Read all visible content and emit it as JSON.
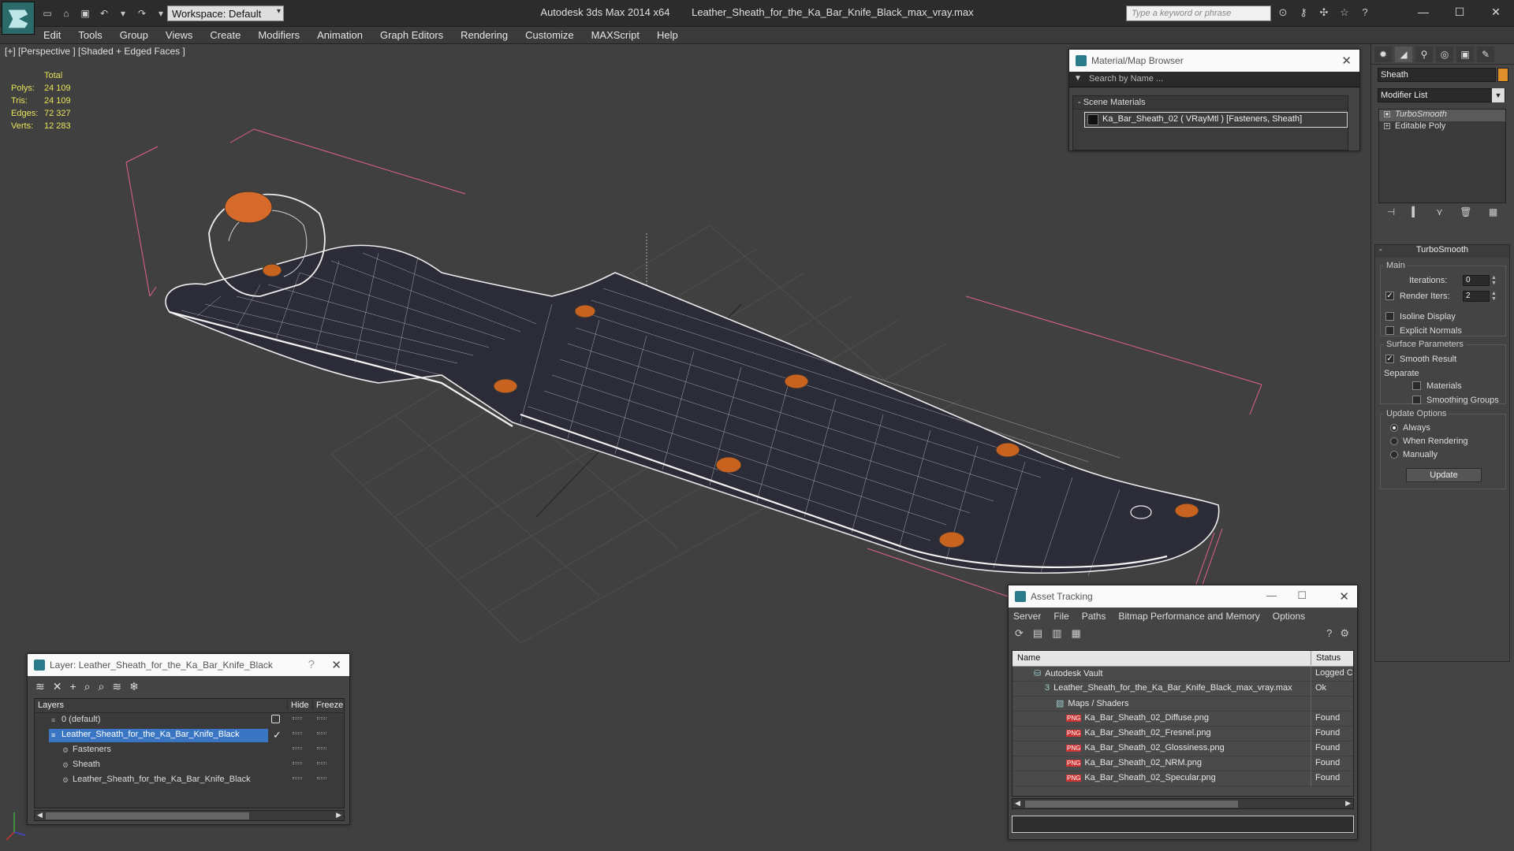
{
  "titlebar": {
    "workspace": "Workspace: Default",
    "app_title": "Autodesk 3ds Max  2014 x64",
    "file_title": "Leather_Sheath_for_the_Ka_Bar_Knife_Black_max_vray.max",
    "search_placeholder": "Type a keyword or phrase"
  },
  "menu": [
    "Edit",
    "Tools",
    "Group",
    "Views",
    "Create",
    "Modifiers",
    "Animation",
    "Graph Editors",
    "Rendering",
    "Customize",
    "MAXScript",
    "Help"
  ],
  "viewport": {
    "label": "[+] [Perspective ] [Shaded + Edged Faces ]",
    "stats": {
      "total_label": "Total",
      "rows": [
        {
          "k": "Polys:",
          "v": "24 109"
        },
        {
          "k": "Tris:",
          "v": "24 109"
        },
        {
          "k": "Edges:",
          "v": "72 327"
        },
        {
          "k": "Verts:",
          "v": "12 283"
        }
      ]
    }
  },
  "material_browser": {
    "title": "Material/Map Browser",
    "search_placeholder": "Search by Name ...",
    "group": "- Scene Materials",
    "item": "Ka_Bar_Sheath_02  ( VRayMtl )  [Fasteners, Sheath]"
  },
  "command_panel": {
    "object_name": "Sheath",
    "object_color": "#e08f2a",
    "modifier_list": "Modifier List",
    "stack": [
      "TurboSmooth",
      "Editable Poly"
    ],
    "rollout_title": "TurboSmooth",
    "main_label": "Main",
    "iterations_label": "Iterations:",
    "iterations": "0",
    "render_iters_label": "Render Iters:",
    "render_iters": "2",
    "isoline": "Isoline Display",
    "explicit_normals": "Explicit Normals",
    "surface_params": "Surface Parameters",
    "smooth_result": "Smooth Result",
    "separate": "Separate",
    "materials": "Materials",
    "smoothing_groups": "Smoothing Groups",
    "update_options": "Update Options",
    "always": "Always",
    "when_rendering": "When Rendering",
    "manually": "Manually",
    "update_btn": "Update"
  },
  "layer_dialog": {
    "title": "Layer: Leather_Sheath_for_the_Ka_Bar_Knife_Black",
    "col_layers": "Layers",
    "col_hide": "Hide",
    "col_freeze": "Freeze",
    "rows": [
      {
        "name": "0 (default)",
        "indent": 1
      },
      {
        "name": "Leather_Sheath_for_the_Ka_Bar_Knife_Black",
        "indent": 1
      },
      {
        "name": "Fasteners",
        "indent": 2
      },
      {
        "name": "Sheath",
        "indent": 2
      },
      {
        "name": "Leather_Sheath_for_the_Ka_Bar_Knife_Black",
        "indent": 2
      }
    ]
  },
  "asset_tracking": {
    "title": "Asset Tracking",
    "menu": [
      "Server",
      "File",
      "Paths",
      "Bitmap Performance and Memory",
      "Options"
    ],
    "col_name": "Name",
    "col_status": "Status",
    "rows": [
      {
        "name": "Autodesk Vault",
        "status": "Logged C",
        "indent": 26,
        "icon": "vault"
      },
      {
        "name": "Leather_Sheath_for_the_Ka_Bar_Knife_Black_max_vray.max",
        "status": "Ok",
        "indent": 40,
        "icon": "max"
      },
      {
        "name": "Maps / Shaders",
        "status": "",
        "indent": 54,
        "icon": "maps"
      },
      {
        "name": "Ka_Bar_Sheath_02_Diffuse.png",
        "status": "Found",
        "indent": 68,
        "icon": "png"
      },
      {
        "name": "Ka_Bar_Sheath_02_Fresnel.png",
        "status": "Found",
        "indent": 68,
        "icon": "png"
      },
      {
        "name": "Ka_Bar_Sheath_02_Glossiness.png",
        "status": "Found",
        "indent": 68,
        "icon": "png"
      },
      {
        "name": "Ka_Bar_Sheath_02_NRM.png",
        "status": "Found",
        "indent": 68,
        "icon": "png"
      },
      {
        "name": "Ka_Bar_Sheath_02_Specular.png",
        "status": "Found",
        "indent": 68,
        "icon": "png"
      }
    ]
  }
}
